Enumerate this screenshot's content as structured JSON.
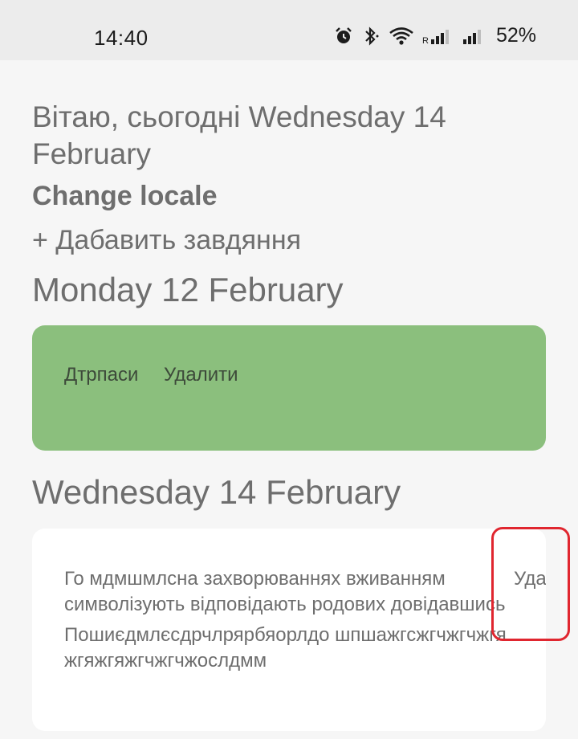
{
  "status_bar": {
    "time": "14:40",
    "battery": "52%",
    "icons": [
      "alarm-icon",
      "bluetooth-icon",
      "wifi-icon",
      "signal-icon",
      "signal-icon"
    ]
  },
  "header": {
    "greeting": "Вітаю, сьогодні Wednesday 14 February",
    "change_locale": "Change locale",
    "add_task": "+ Дабавить завдяння"
  },
  "days": [
    {
      "heading": "Monday 12 February",
      "tasks": [
        {
          "text": "Дтрпаси",
          "delete_label": "Удалити",
          "status": "done",
          "color": "#8bbf7d"
        }
      ]
    },
    {
      "heading": "Wednesday 14 February",
      "tasks": [
        {
          "text": "Го мдмшмлсна захворюваннях вживанням символізують відповідають родових довідавшись",
          "text2": "Пошиєдмлєсдрчлрярбяорлдо шпшажгсжгчжгчжгяжгяжгяжгчжгчжослдмм",
          "delete_label": "Удалити",
          "status": "open",
          "color": "#ffffff"
        }
      ]
    }
  ],
  "colors": {
    "highlight": "#e0262f",
    "background": "#f6f6f6",
    "text": "#6e6e6e"
  }
}
